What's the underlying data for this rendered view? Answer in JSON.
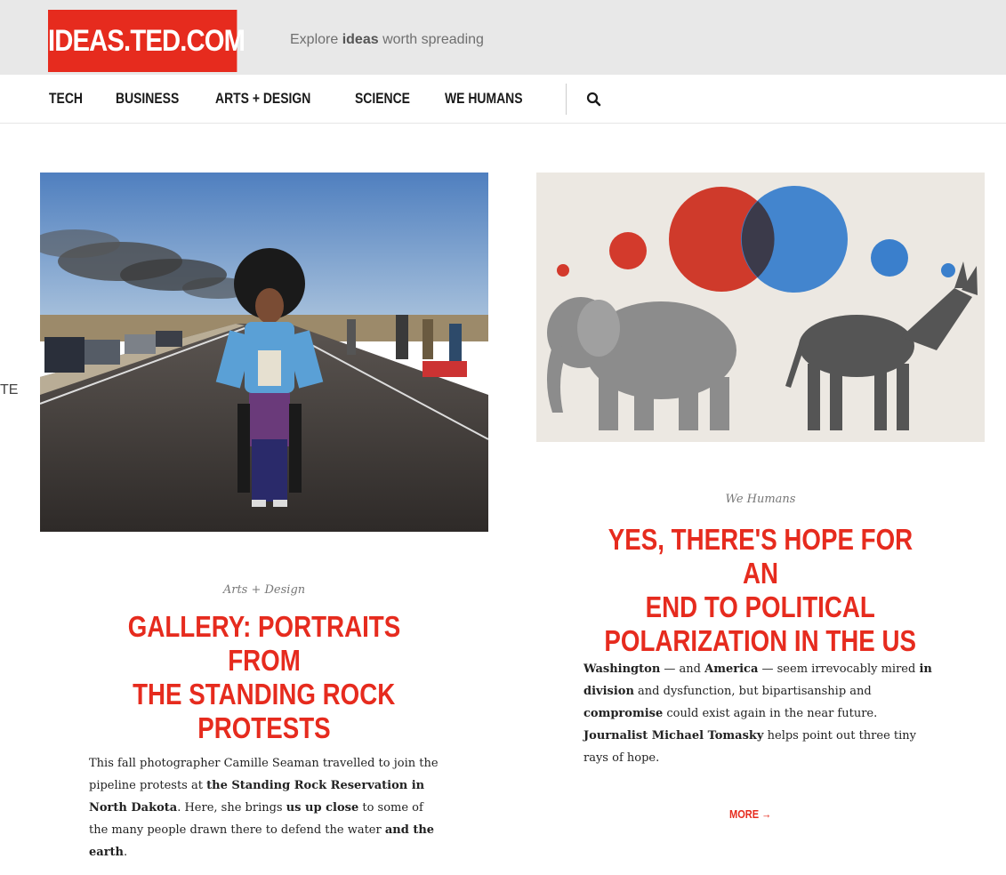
{
  "header": {
    "logo": "IDEAS.TED.COM",
    "tagline_prefix": "Explore ",
    "tagline_bold": "ideas",
    "tagline_suffix": " worth spreading"
  },
  "nav": {
    "items": [
      "TECH",
      "BUSINESS",
      "ARTS + DESIGN",
      "SCIENCE",
      "WE HUMANS"
    ],
    "search_icon": "search-icon"
  },
  "edge_text": "TE",
  "articles": [
    {
      "category": "Arts + Design",
      "headline_lines": [
        "GALLERY: PORTRAITS FROM",
        "THE STANDING ROCK",
        "PROTESTS"
      ],
      "excerpt": [
        {
          "text": "This fall photographer Camille Seaman travelled to join the pipeline protests at ",
          "bold": false
        },
        {
          "text": "the Standing Rock Reservation in North Dakota",
          "bold": true
        },
        {
          "text": ". Here, she brings ",
          "bold": false
        },
        {
          "text": "us up close",
          "bold": true
        },
        {
          "text": " to some of the many people drawn there to defend the water ",
          "bold": false
        },
        {
          "text": "and the earth",
          "bold": true
        },
        {
          "text": ".",
          "bold": false
        }
      ]
    },
    {
      "category": "We Humans",
      "headline_lines": [
        "YES, THERE'S HOPE FOR AN",
        "END TO POLITICAL",
        "POLARIZATION IN THE US"
      ],
      "excerpt": [
        {
          "text": "Washington",
          "bold": true
        },
        {
          "text": " — and ",
          "bold": false
        },
        {
          "text": "America",
          "bold": true
        },
        {
          "text": " — seem irrevocably mired ",
          "bold": false
        },
        {
          "text": "in division",
          "bold": true
        },
        {
          "text": " and dysfunction, but bipartisanship and ",
          "bold": false
        },
        {
          "text": "compromise",
          "bold": true
        },
        {
          "text": " could exist again in the near future. ",
          "bold": false
        },
        {
          "text": "Journalist Michael Tomasky",
          "bold": true
        },
        {
          "text": " helps point out three tiny rays of hope.",
          "bold": false
        }
      ],
      "more_label": "MORE →"
    }
  ],
  "colors": {
    "brand_red": "#e62b1e",
    "header_gray": "#e8e8e8"
  }
}
